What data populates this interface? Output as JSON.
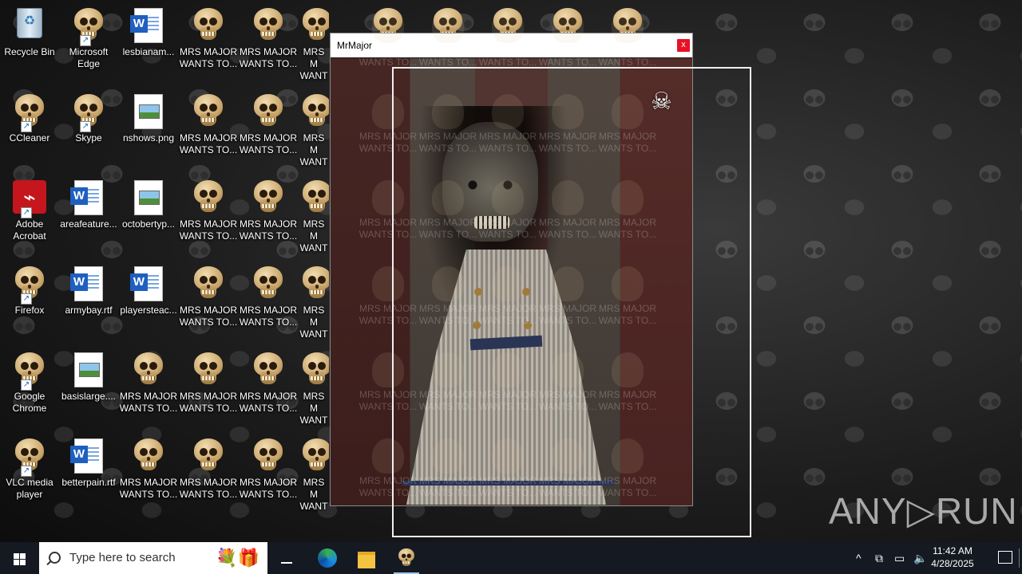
{
  "desktop": {
    "icons": [
      {
        "label": "Recycle Bin",
        "kind": "bin"
      },
      {
        "label": "Microsoft Edge",
        "kind": "skull",
        "shortcut": true
      },
      {
        "label": "lesbianam...",
        "kind": "word"
      },
      {
        "label": "CCleaner",
        "kind": "skull",
        "shortcut": true
      },
      {
        "label": "Skype",
        "kind": "skull",
        "shortcut": true
      },
      {
        "label": "nshows.png",
        "kind": "img"
      },
      {
        "label": "Adobe Acrobat",
        "kind": "acrobat",
        "shortcut": true
      },
      {
        "label": "areafeature...",
        "kind": "word"
      },
      {
        "label": "octobertyp...",
        "kind": "img"
      },
      {
        "label": "Firefox",
        "kind": "skull",
        "shortcut": true
      },
      {
        "label": "armybay.rtf",
        "kind": "word"
      },
      {
        "label": "playersteac...",
        "kind": "word"
      },
      {
        "label": "Google Chrome",
        "kind": "skull",
        "shortcut": true
      },
      {
        "label": "basislarge....",
        "kind": "img"
      },
      {
        "label": "VLC media player",
        "kind": "skull",
        "shortcut": true
      },
      {
        "label": "betterpain.rtf",
        "kind": "word"
      }
    ],
    "mrs_major_label": "MRS MAJOR WANTS TO...",
    "mrs_major_short": "MRS M WANT"
  },
  "window": {
    "title": "MrMajor",
    "close_label": "x",
    "jolly_roger": "☠"
  },
  "watermark": "ANY▷RUN",
  "taskbar": {
    "search_placeholder": "Type here to search",
    "search_art": "💐🎁",
    "clock_time": "11:42 AM",
    "clock_date": "4/28/2025",
    "tray_chevron": "^"
  },
  "colors": {
    "taskbar": "#141922",
    "close_button": "#e81123",
    "word_blue": "#1f5fbf",
    "acrobat_red": "#c4161c"
  }
}
